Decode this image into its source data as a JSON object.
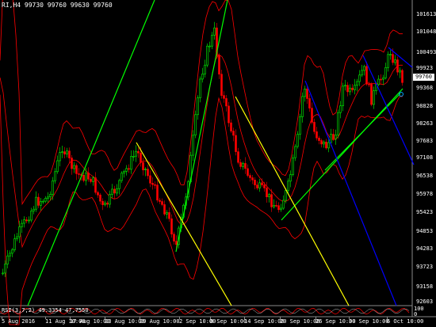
{
  "header": {
    "symbol_ohlc": "RI,H4  99730 99760 99630 99760"
  },
  "indicator": {
    "label": "RSI(3,7,2) 49.3354 47.7550",
    "axis_top": "100",
    "axis_bottom": "0"
  },
  "price_axis": {
    "ticks": [
      "101613",
      "101048",
      "100493",
      "99923",
      "99368",
      "98828",
      "98263",
      "97683",
      "97108",
      "96538",
      "95978",
      "95423",
      "94853",
      "94283",
      "93723",
      "93158",
      "92603"
    ],
    "current_price": "99760"
  },
  "date_axis": {
    "ticks": [
      "5 Aug 2016",
      "11 Aug 10:00",
      "17 Aug 10:00",
      "23 Aug 10:00",
      "29 Aug 10:00",
      "2 Sep 10:00",
      "8 Sep 10:00",
      "14 Sep 10:00",
      "20 Sep 10:00",
      "26 Sep 10:00",
      "30 Sep 10:00",
      "6 Oct 10:00"
    ]
  },
  "colors": {
    "background": "#000000",
    "bull_candle": "#00ff00",
    "bear_candle": "#ff0000",
    "bollinger": "#ff0000",
    "trend_green": "#00ff00",
    "trend_yellow": "#ffff00",
    "trend_blue": "#0000ff"
  }
}
